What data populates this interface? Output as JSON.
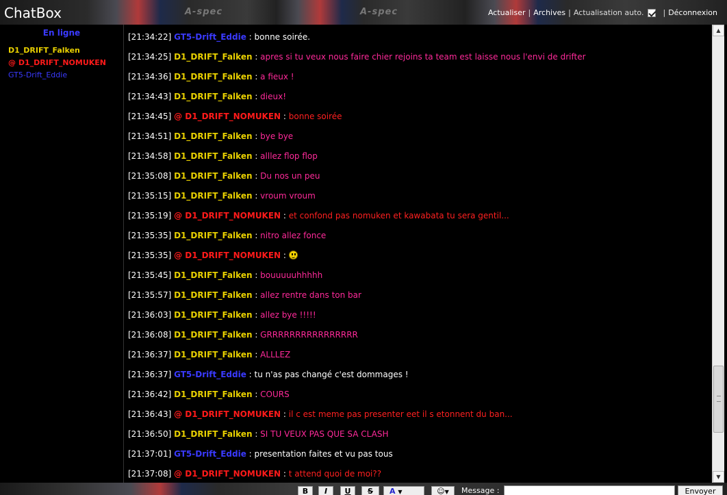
{
  "header": {
    "brand": "ChatBox",
    "banner_text": "A-spec",
    "nav": {
      "refresh": "Actualiser",
      "archives": "Archives",
      "auto_refresh": "Actualisation auto.",
      "logout": "Déconnexion",
      "separator": "|"
    }
  },
  "sidebar": {
    "title": "En ligne",
    "users": [
      {
        "name": "D1_DRIFT_Falken",
        "color": "#e8d000"
      },
      {
        "name": "@ D1_DRIFT_NOMUKEN",
        "color": "#ff1a1a"
      },
      {
        "name": "GT5-Drift_Eddie",
        "color": "#3a3aff"
      }
    ]
  },
  "colors": {
    "falken": "#e8d000",
    "nomuken": "#ff1a1a",
    "eddie": "#3a3aff",
    "pink_text": "#ff2a9a",
    "red_text": "#ff2020",
    "white_text": "#ffffff"
  },
  "messages": [
    {
      "time": "[21:34:22]",
      "nick": "GT5-Drift_Eddie",
      "sep": " : ",
      "text": "bonne soirée."
    },
    {
      "time": "[21:34:25]",
      "nick": "D1_DRIFT_Falken",
      "sep": " : ",
      "text": "apres si tu veux nous faire chier rejoins ta team est laisse nous l'envi de drifter"
    },
    {
      "time": "[21:34:36]",
      "nick": "D1_DRIFT_Falken",
      "sep": " : ",
      "text": "a fieux !"
    },
    {
      "time": "[21:34:43]",
      "nick": "D1_DRIFT_Falken",
      "sep": " : ",
      "text": "dieux!"
    },
    {
      "time": "[21:34:45]",
      "nick": "@ D1_DRIFT_NOMUKEN",
      "sep": " : ",
      "text": "bonne soirée"
    },
    {
      "time": "[21:34:51]",
      "nick": "D1_DRIFT_Falken",
      "sep": " : ",
      "text": "bye bye"
    },
    {
      "time": "[21:34:58]",
      "nick": "D1_DRIFT_Falken",
      "sep": " : ",
      "text": "alllez flop flop"
    },
    {
      "time": "[21:35:08]",
      "nick": "D1_DRIFT_Falken",
      "sep": " : ",
      "text": "Du nos un peu"
    },
    {
      "time": "[21:35:15]",
      "nick": "D1_DRIFT_Falken",
      "sep": " : ",
      "text": "vroum vroum"
    },
    {
      "time": "[21:35:19]",
      "nick": "@ D1_DRIFT_NOMUKEN",
      "sep": " : ",
      "text": "et confond pas nomuken et kawabata tu sera gentil..."
    },
    {
      "time": "[21:35:35]",
      "nick": "D1_DRIFT_Falken",
      "sep": " : ",
      "text": "nitro allez fonce"
    },
    {
      "time": "[21:35:35]",
      "nick": "@ D1_DRIFT_NOMUKEN",
      "sep": " : ",
      "text": "",
      "smiley": true
    },
    {
      "time": "[21:35:45]",
      "nick": "D1_DRIFT_Falken",
      "sep": " : ",
      "text": "bouuuuuhhhhh"
    },
    {
      "time": "[21:35:57]",
      "nick": "D1_DRIFT_Falken",
      "sep": " : ",
      "text": "allez rentre dans ton bar"
    },
    {
      "time": "[21:36:03]",
      "nick": "D1_DRIFT_Falken",
      "sep": " : ",
      "text": "allez bye !!!!!"
    },
    {
      "time": "[21:36:08]",
      "nick": "D1_DRIFT_Falken",
      "sep": " : ",
      "text": "GRRRRRRRRRRRRRRRR"
    },
    {
      "time": "[21:36:37]",
      "nick": "D1_DRIFT_Falken",
      "sep": " : ",
      "text": "ALLLEZ"
    },
    {
      "time": "[21:36:37]",
      "nick": "GT5-Drift_Eddie",
      "sep": " : ",
      "text": "tu n'as pas changé c'est dommages !"
    },
    {
      "time": "[21:36:42]",
      "nick": "D1_DRIFT_Falken",
      "sep": " : ",
      "text": "COURS"
    },
    {
      "time": "[21:36:43]",
      "nick": "@ D1_DRIFT_NOMUKEN",
      "sep": " : ",
      "text": "il c est meme pas presenter eet il s etonnent du ban..."
    },
    {
      "time": "[21:36:50]",
      "nick": "D1_DRIFT_Falken",
      "sep": " : ",
      "text": "SI TU VEUX PAS QUE SA CLASH"
    },
    {
      "time": "[21:37:01]",
      "nick": "GT5-Drift_Eddie",
      "sep": " : ",
      "text": "presentation faites et vu pas tous"
    },
    {
      "time": "[21:37:08]",
      "nick": "@ D1_DRIFT_NOMUKEN",
      "sep": " : ",
      "text": "t attend quoi de moi??"
    }
  ],
  "footer": {
    "bold": "B",
    "italic": "I",
    "underline": "U",
    "strike": "S",
    "color": "A",
    "message_label": "Message :",
    "message_value": "",
    "send": "Envoyer"
  }
}
